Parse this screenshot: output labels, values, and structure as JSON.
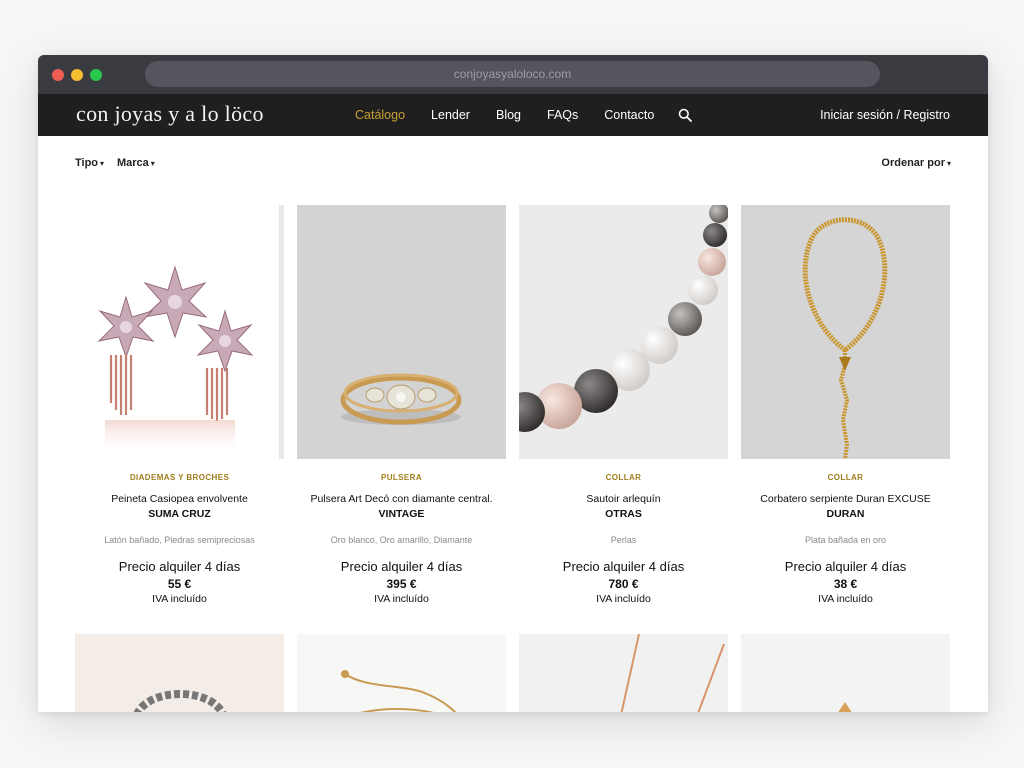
{
  "browser": {
    "url": "conjoyasyaloloco.com"
  },
  "nav": {
    "logo": "con joyas y a lo löco",
    "links": [
      "Catálogo",
      "Lender",
      "Blog",
      "FAQs",
      "Contacto"
    ],
    "active_link": "Catálogo",
    "auth": "Iniciar sesión / Registro",
    "accent_color": "#c9a032"
  },
  "filters": {
    "tipo": "Tipo",
    "marca": "Marca",
    "order": "Ordenar por"
  },
  "products": [
    {
      "category": "DIADEMAS Y BROCHES",
      "name": "Peineta Casiopea envolvente",
      "brand": "SUMA CRUZ",
      "materials": "Latón bañado, Piedras semipreciosas",
      "price_label": "Precio alquiler 4 días",
      "price": "55 €",
      "tax": "IVA incluído"
    },
    {
      "category": "PULSERA",
      "name": "Pulsera Art Decó con diamante central.",
      "brand": "VINTAGE",
      "materials": "Oro blanco, Oro amarillo, Diamante",
      "price_label": "Precio alquiler 4 días",
      "price": "395 €",
      "tax": "IVA incluído"
    },
    {
      "category": "COLLAR",
      "name": "Sautoir arlequín",
      "brand": "OTRAS",
      "materials": "Perlas",
      "price_label": "Precio alquiler 4 días",
      "price": "780 €",
      "tax": "IVA incluído"
    },
    {
      "category": "COLLAR",
      "name": "Corbatero serpiente Duran EXCUSE",
      "brand": "DURAN",
      "materials": "Plata bañada en oro",
      "price_label": "Precio alquiler 4 días",
      "price": "38 €",
      "tax": "IVA incluído"
    }
  ]
}
